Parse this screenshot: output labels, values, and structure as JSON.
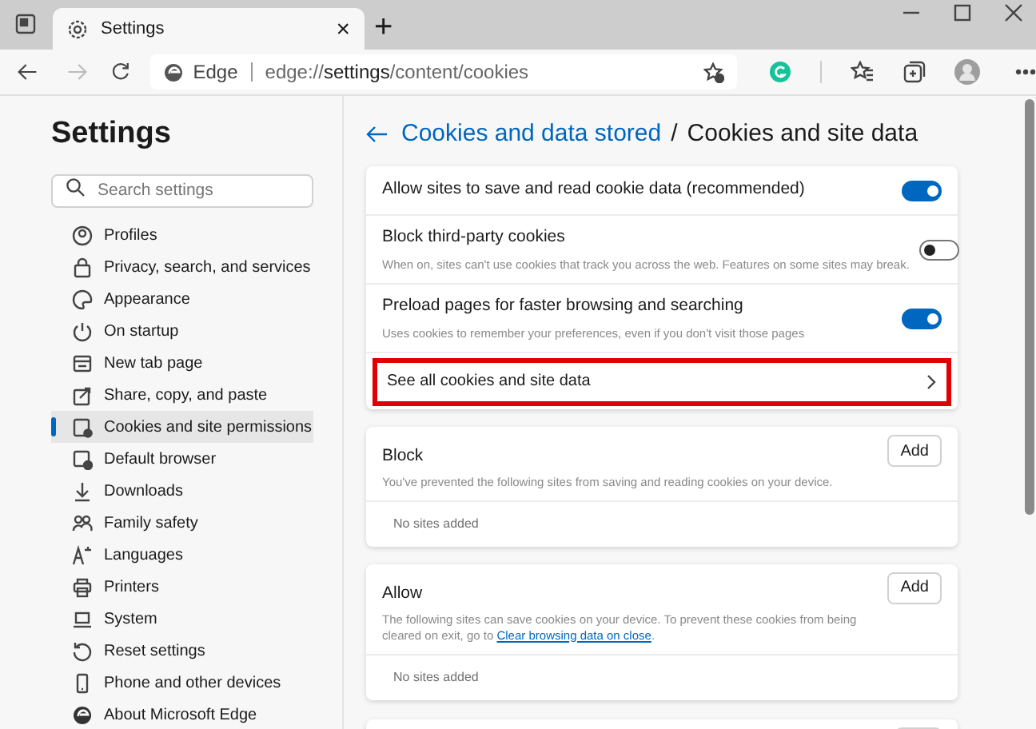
{
  "tab": {
    "title": "Settings",
    "close": "×",
    "new_tab": "+"
  },
  "address_bar": {
    "site_label": "Edge",
    "url_prefix": "edge://",
    "url_bold": "settings",
    "url_rest": "/content/cookies"
  },
  "sidebar": {
    "title": "Settings",
    "search": {
      "placeholder": "Search settings"
    },
    "items": [
      {
        "label": "Profiles",
        "selected": false
      },
      {
        "label": "Privacy, search, and services",
        "selected": false
      },
      {
        "label": "Appearance",
        "selected": false
      },
      {
        "label": "On startup",
        "selected": false
      },
      {
        "label": "New tab page",
        "selected": false
      },
      {
        "label": "Share, copy, and paste",
        "selected": false
      },
      {
        "label": "Cookies and site permissions",
        "selected": true
      },
      {
        "label": "Default browser",
        "selected": false
      },
      {
        "label": "Downloads",
        "selected": false
      },
      {
        "label": "Family safety",
        "selected": false
      },
      {
        "label": "Languages",
        "selected": false
      },
      {
        "label": "Printers",
        "selected": false
      },
      {
        "label": "System",
        "selected": false
      },
      {
        "label": "Reset settings",
        "selected": false
      },
      {
        "label": "Phone and other devices",
        "selected": false
      },
      {
        "label": "About Microsoft Edge",
        "selected": false
      }
    ]
  },
  "header": {
    "breadcrumb_link": "Cookies and data stored",
    "separator": "/",
    "title": "Cookies and site data"
  },
  "settings": [
    {
      "kind": "toggle",
      "label": "Allow sites to save and read cookie data (recommended)",
      "on": true
    },
    {
      "kind": "toggle",
      "label": "Block third-party cookies",
      "description": "When on, sites can't use cookies that track you across the web. Features on some sites may break.",
      "on": false
    },
    {
      "kind": "toggle",
      "label": "Preload pages for faster browsing and searching",
      "description": "Uses cookies to remember your preferences, even if you don't visit those pages",
      "on": true
    },
    {
      "kind": "link",
      "label": "See all cookies and site data",
      "highlighted": true
    }
  ],
  "lists": [
    {
      "title": "Block",
      "description": "You've prevented the following sites from saving and reading cookies on your device.",
      "button": "Add",
      "empty": "No sites added"
    },
    {
      "title": "Allow",
      "description": "The following sites can save cookies on your device. To prevent these cookies from being cleared on exit, go to ",
      "link": "Clear browsing data on close",
      "description_end": ".",
      "button": "Add",
      "empty": "No sites added"
    }
  ]
}
